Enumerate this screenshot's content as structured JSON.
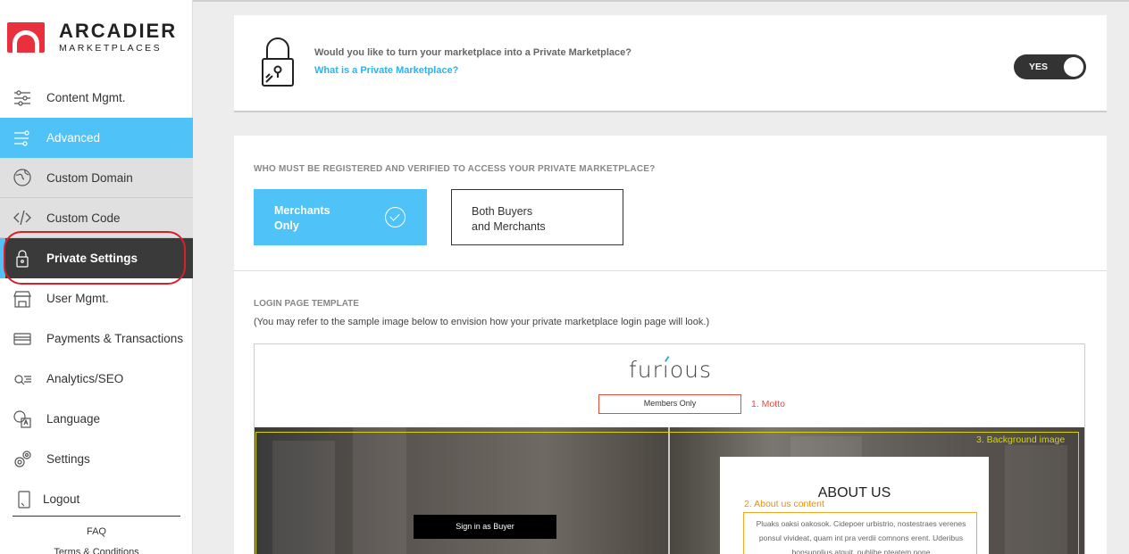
{
  "brand": {
    "name": "ARCADIER",
    "sub": "MARKETPLACES"
  },
  "sidebar": {
    "items": [
      {
        "label": "Content Mgmt.",
        "icon": "sliders-icon"
      },
      {
        "label": "Advanced",
        "icon": "advanced-icon"
      },
      {
        "label": "Custom Domain",
        "icon": "globe-icon"
      },
      {
        "label": "Custom Code",
        "icon": "code-icon"
      },
      {
        "label": "Private Settings",
        "icon": "lock-icon"
      },
      {
        "label": "User Mgmt.",
        "icon": "store-icon"
      },
      {
        "label": "Payments & Transactions",
        "icon": "card-icon"
      },
      {
        "label": "Analytics/SEO",
        "icon": "analytics-icon"
      },
      {
        "label": "Language",
        "icon": "language-icon"
      },
      {
        "label": "Settings",
        "icon": "gear-icon"
      },
      {
        "label": "Logout",
        "icon": "logout-icon"
      }
    ],
    "faq": "FAQ",
    "terms": "Terms & Conditions"
  },
  "private_toggle": {
    "question": "Would you like to turn your marketplace into a Private Marketplace?",
    "link": "What is a Private Marketplace?",
    "toggle_label": "YES"
  },
  "access": {
    "heading": "WHO MUST BE REGISTERED AND VERIFIED TO ACCESS YOUR PRIVATE MARKETPLACE?",
    "options": [
      {
        "label": "Merchants\nOnly",
        "selected": true
      },
      {
        "label": "Both Buyers\nand Merchants",
        "selected": false
      }
    ]
  },
  "login_template": {
    "heading": "LOGIN PAGE TEMPLATE",
    "note": "(You may refer to the sample image below to envision how your private marketplace login page will look.)",
    "sample": {
      "brand": "furious",
      "motto": "Members Only",
      "motto_label": "1. Motto",
      "bg_label": "3. Background image",
      "signin": "Sign in as Buyer",
      "about_title": "ABOUT US",
      "about_label": "2. About us content",
      "about_text": "Pluaks oaksi oakosok. Cidepoer urbistrio, nostestraes verenes ponsul vivideat, quam int pra verdii comnons erent. Uderibus bonsupplius atquit, publibe nteatem none"
    }
  },
  "colors": {
    "accent": "#4fc3f7",
    "active": "#3a3a3a",
    "highlight": "#d9202a",
    "link": "#2bb3f0"
  }
}
